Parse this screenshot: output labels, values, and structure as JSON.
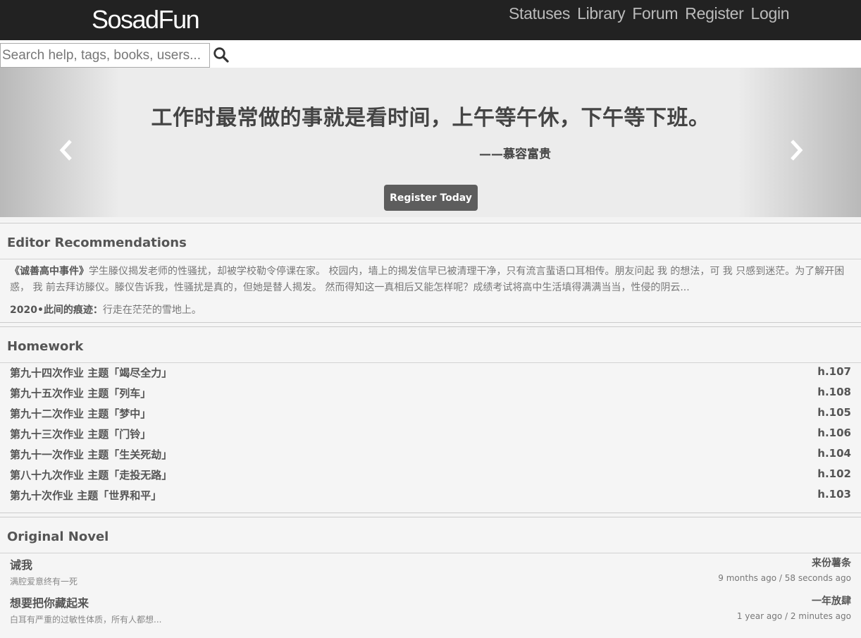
{
  "navbar": {
    "brand": "SosadFun",
    "links": [
      "Statuses",
      "Library",
      "Forum",
      "Register",
      "Login"
    ]
  },
  "search": {
    "placeholder": "Search help, tags, books, users...",
    "icon": "search-icon"
  },
  "carousel": {
    "quote": "工作时最常做的事就是看时间，上午等午休，下午等下班。",
    "author": "——慕容富贵",
    "register_label": "Register Today",
    "prev_icon": "chevron-left-icon",
    "next_icon": "chevron-right-icon"
  },
  "editor": {
    "heading": "Editor Recommendations",
    "item1_title": "《诚善高中事件》",
    "item1_text": "学生滕仪揭发老师的性骚扰，却被学校勒令停课在家。 校园内，墙上的揭发信早已被清理干净，只有流言蜚语口耳相传。朋友问起 我 的想法，可 我 只感到迷茫。为了解开困惑， 我 前去拜访滕仪。滕仪告诉我，性骚扰是真的，但她是替人揭发。 然而得知这一真相后又能怎样呢？成绩考试将高中生活填得满满当当，性侵的阴云...",
    "item2_title": "2020•此间的痕迹：",
    "item2_text": "行走在茫茫的雪地上。"
  },
  "homework": {
    "heading": "Homework",
    "items": [
      {
        "title": "第九十四次作业 主题「竭尽全力」",
        "tag": "h.107"
      },
      {
        "title": "第九十五次作业 主题「列车」",
        "tag": "h.108"
      },
      {
        "title": "第九十二次作业 主题「梦中」",
        "tag": "h.105"
      },
      {
        "title": "第九十三次作业 主题「门铃」",
        "tag": "h.106"
      },
      {
        "title": "第九十一次作业 主题「生关死劫」",
        "tag": "h.104"
      },
      {
        "title": "第八十九次作业 主题「走投无路」",
        "tag": "h.102"
      },
      {
        "title": "第九十次作业 主题「世界和平」",
        "tag": "h.103"
      }
    ]
  },
  "novel": {
    "heading": "Original Novel",
    "items": [
      {
        "title": "诫我",
        "brief": "满腔爱意终有一死",
        "author": "来份薯条",
        "time": "9 months ago / 58 seconds ago"
      },
      {
        "title": "想要把你藏起来",
        "brief": "白耳有严重的过敏性体质，所有人都想...",
        "author": "一年放肆",
        "time": "1 year ago / 2 minutes ago"
      }
    ]
  },
  "colors": {
    "navbar_bg": "#222222",
    "button_bg": "#5d5d5d",
    "page_bg": "#f5f5f5"
  }
}
